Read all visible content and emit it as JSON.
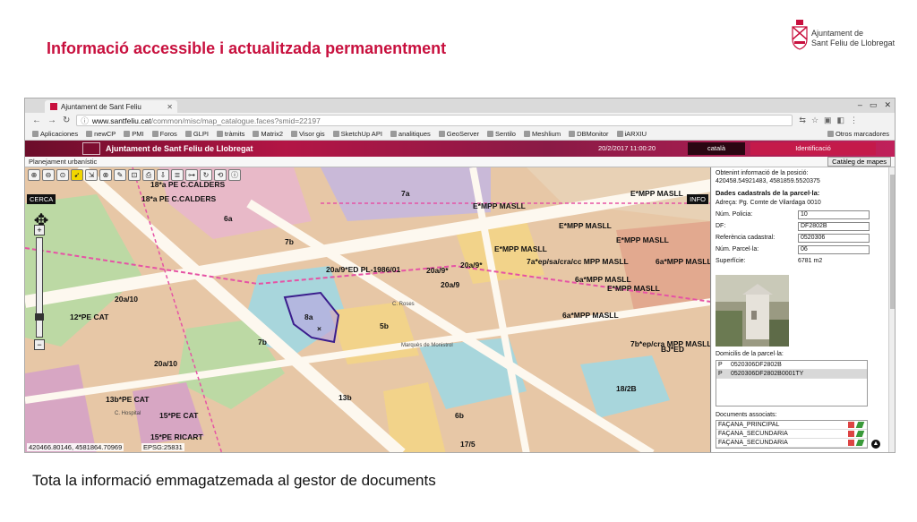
{
  "slide": {
    "title": "Informació accessible i actualitzada permanentment",
    "caption": "Tota la informació emmagatzemada al gestor de documents",
    "logo_line1": "Ajuntament de",
    "logo_line2": "Sant Feliu de Llobregat"
  },
  "browser": {
    "tab_title": "Ajuntament de Sant Feliu",
    "url_domain": "www.santfeliu.cat",
    "url_path": "/common/misc/map_catalogue.faces?smid=22197",
    "bookmarks": [
      "Aplicaciones",
      "newCP",
      "PMI",
      "Foros",
      "GLPI",
      "tràmits",
      "Matrix2",
      "Visor gis",
      "SketchUp API",
      "analitiques",
      "GeoServer",
      "Sentilo",
      "Meshlium",
      "DBMonitor",
      "iARXIU"
    ],
    "other_bookmarks": "Otros marcadores"
  },
  "app": {
    "title": "Ajuntament de Sant Feliu de Llobregat",
    "datetime": "20/2/2017 11:00:20",
    "language": "català",
    "login": "Identificació",
    "section": "Planejament urbanístic",
    "catalog_button": "Catàleg de mapes"
  },
  "map": {
    "search_label": "CERCA",
    "info_label": "INFO",
    "coordinates": "420466.80146, 4581864.70969",
    "epsg": "EPSG:25831",
    "labels": [
      "18*a PE C.CALDERS",
      "18*a PE C.CALDERS",
      "E*MPP MASLL",
      "E*MPP MASLL",
      "E*MPP MASLL",
      "E*MPP MASLL",
      "E*MPP MASLL",
      "E*MPP MASLL",
      "6a*MPP MASLL",
      "6a*MPP MASLL",
      "6a*MPP MASLL",
      "20a/9*ED PL-1986/01",
      "20a/9*",
      "20a/9*",
      "20a/9",
      "7a*ep/sa/cra/cc MPP MASLL",
      "7b*ep/cra MPP MASLL",
      "12*PE CAT",
      "13b*PE CAT",
      "15*PE CAT",
      "15*PE RICART",
      "8a",
      "7a",
      "7b",
      "6a",
      "5b",
      "13b",
      "6b",
      "20a/10",
      "17/5",
      "18/2B",
      "BJ*ED",
      "C. Roses",
      "Marquès de Monistrol",
      "C. Hospital"
    ]
  },
  "panel": {
    "position_title": "Obtenint informació de la posició:",
    "position_value": "420458.54921483, 4581859.5520375",
    "cadastral_title": "Dades cadastrals de la parcel·la:",
    "address": "Adreça: Pg. Comte de Vilardaga 0010",
    "fields": [
      {
        "label": "Núm. Policia:",
        "value": "10"
      },
      {
        "label": "DF:",
        "value": "DF2802B"
      },
      {
        "label": "Referència cadastral:",
        "value": "0520306"
      },
      {
        "label": "Núm. Parcel·la:",
        "value": "06"
      }
    ],
    "surface_label": "Superfície:",
    "surface_value": "6781 m2",
    "domiciles_title": "Domicilis de la parcel·la:",
    "domiciles": [
      {
        "type": "P",
        "code": "0520306DF2802B"
      },
      {
        "type": "P",
        "code": "0520306DF2802B0001TY"
      }
    ],
    "documents_title": "Documents associats:",
    "documents": [
      "FAÇANA_PRINCIPAL",
      "FAÇANA_SECUNDARIA",
      "FAÇANA_SECUNDARIA"
    ]
  }
}
